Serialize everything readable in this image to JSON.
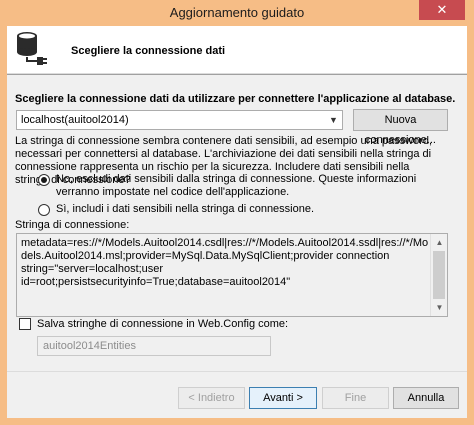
{
  "window": {
    "title": "Aggiornamento guidato",
    "close_glyph": "✕"
  },
  "header": {
    "title": "Scegliere la connessione dati",
    "icon": "database-plug-icon"
  },
  "connection": {
    "choose_label": "Scegliere la connessione dati da utilizzare per connettere l'applicazione al database.",
    "selected": "localhost(auitool2014)",
    "new_button": "Nuova connessione...",
    "warning": "La stringa di connessione sembra contenere dati sensibili, ad esempio una password, necessari per connettersi al database. L'archiviazione dei dati sensibili nella stringa di connessione rappresenta un rischio per la sicurezza. Includere dati sensibili nella stringa di connessione?",
    "radio_exclude": "No, escludi dati sensibili dalla stringa di connessione. Queste informazioni verranno impostate nel codice dell'applicazione.",
    "radio_include": "Sì, includi i dati sensibili nella stringa di connessione.",
    "string_label": "Stringa di connessione:",
    "string_value": "metadata=res://*/Models.Auitool2014.csdl|res://*/Models.Auitool2014.ssdl|res://*/Models.Auitool2014.msl;provider=MySql.Data.MySqlClient;provider connection string=\"server=localhost;user id=root;persistsecurityinfo=True;database=auitool2014\"",
    "save_checkbox_label": "Salva stringhe di connessione in Web.Config come:",
    "save_name": "auitool2014Entities",
    "radio_exclude_checked": true,
    "save_checked": false
  },
  "footer": {
    "back": "< Indietro",
    "next": "Avanti >",
    "finish": "Fine",
    "cancel": "Annulla"
  },
  "colors": {
    "titlebar": "#f6bd86",
    "close": "#c74b50",
    "accent_border": "#3c7fb1"
  }
}
